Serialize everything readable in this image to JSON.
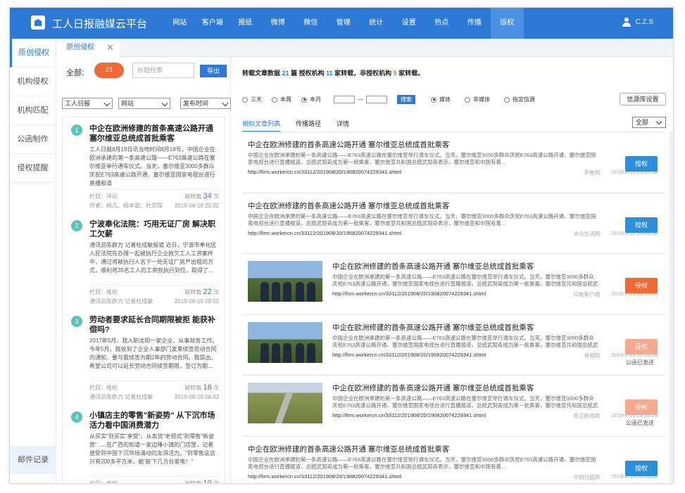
{
  "app": {
    "title": "工人日报融媒云平台",
    "user": "C.Z.S"
  },
  "nav": [
    "网站",
    "客户端",
    "报纸",
    "微博",
    "微信",
    "管理",
    "统计",
    "设置",
    "热点",
    "传播",
    "版权"
  ],
  "nav_active": "版权",
  "sidebar": {
    "items": [
      "原创侵权",
      "机构侵权",
      "机构匹配",
      "公函制作",
      "侵权提醒"
    ],
    "bottom": "邮件记录"
  },
  "tab": {
    "label": "原创侵权",
    "close": "✕"
  },
  "left": {
    "total_label": "全部:",
    "total_count": "21",
    "search_placeholder": "标题检索",
    "export": "导出",
    "selects": [
      "工人日报",
      "网站",
      "发布时间"
    ],
    "items": [
      {
        "no": "1",
        "title": "中企在欧洲修建的首条高速公路开通 塞尔维亚总统成首批乘客",
        "body": "工人日报8月19日讯当地时间8月18号，中国企业在欧洲承建的第一条高速公路——E763高速公路在塞尔维亚举行通车仪式。当天，塞尔维亚3000多群众庆祝E763高速公路开通，塞尔维亚国家电视台进行直播报道",
        "meta1_left": "栏目：评论",
        "meta1_right": "被转载",
        "count": "34",
        "unit": "次",
        "meta2_left": "作者：杨凡、杨本歌、杜宗琛",
        "date": "2019-08-19 20:02"
      },
      {
        "no": "2",
        "title": "宁波奉化法院：巧用无证厂房 解决职工欠薪",
        "body": "通讯员陈群力 记者杜成敏报道  近日，宁波市奉化区人民法院在办理一起被执行企业拖欠工人工资案件中，通过将被执行人名下一处无证厂房产出租的方式，顺利将35名工人的工资款执行到位，取得了...",
        "meta1_left": "栏目：维权",
        "meta1_right": "被转载",
        "count": "22",
        "unit": "次",
        "meta2_left": "通讯员陈群力 记者杜成敏",
        "date": "2019-08-19 09:50"
      },
      {
        "no": "3",
        "title": "劳动者要求延长合同期限被拒 能获补偿吗?",
        "body": "2017年5月，我入职沈阳一家企业，从事财务工作。今年5月，我收到了企业人事部门发来续签劳动合同的通知，要与我续签为期2年的劳动合同。我提出，希望公司可以延长劳动合同续签期限，签订为期...",
        "meta1_left": "栏目：维权",
        "meta1_right": "被转载",
        "count": "16",
        "unit": "次",
        "meta2_left": "通讯员陈群力 记者杜成敏",
        "date": "2019-08-18 08:43"
      },
      {
        "no": "4",
        "title": "小镇店主的零售\"新姿势\" 从下沉市场活力看中国消费潜力",
        "body": "从买实\"到买实\"享受\"、从卖货\"老把式\"到零售\"新姿势\"......在广西的知道一家边陲小镇的门店里，记者感受到中国下沉市场涌动的澎湃活力。\"到零售这店只有200多平方米，能'装'下几万台家电！\"",
        "meta1_left": "栏目：维权",
        "meta1_right": "被转载",
        "count": "10",
        "unit": "次",
        "meta2_left": "",
        "date": ""
      }
    ]
  },
  "right": {
    "summary": {
      "p1": "转载文章数据",
      "articles": "21",
      "p2": "篇  授权机构",
      "auth": "11",
      "p3": "家转载，非授权机构",
      "unauth": "5",
      "p4": "家转载。"
    },
    "filter": {
      "r1": "三天",
      "r2": "本周",
      "r3": "本月",
      "dash": "—",
      "search": "搜索",
      "r4": "媒体",
      "r5": "非媒体",
      "r6": "指定信源"
    },
    "source_button": "信源库设置",
    "subtabs": [
      "相似文章列表",
      "传播路径",
      "详情"
    ],
    "all_select": "全部",
    "articles": [
      {
        "title": "中企在欧洲修建的首条高速公路开通 塞尔维亚总统成首批乘客",
        "body": "中国企业在欧洲承建的第一条高速公路——E763高速公路在塞尔维亚举行通车仪式。当天，塞尔维亚3000多群众庆祝E763高速公路开通，塞尔维亚国家电视台进行直播报道，总统武契奇成为第一批乘客，塞尔维亚共和国总统武契奇表示，塞尔维亚和中国有着...",
        "url": "http://firm.workercn.cn/33112/201908/20/190820074229341.shtml",
        "source": "齐鲁网",
        "time": "2019-8-19 20:33:28",
        "button": "授权",
        "btype": "blue",
        "sent": "",
        "thumb": "none"
      },
      {
        "title": "中企在欧洲修建的首条高速公路开通 塞尔维亚总统成首批乘客",
        "body": "中国企业在欧洲承建的第一条高速公路——E763高速公路在塞尔维亚举行通车仪式。当天，塞尔维亚3000多群众庆祝E763高速公路开通，塞尔维亚国家电视台进行直播报道，总统武契奇成为第一批乘客，塞尔维亚共和国总统武契奇表示，塞尔维亚和中国有着...",
        "url": "http://firm.workercn.cn/33112/201908/20/190820074229341.shtml",
        "source": "大众生活网",
        "time": "2019-8-19 20:33:28",
        "button": "授权",
        "btype": "blue",
        "sent": "",
        "thumb": "none"
      },
      {
        "title": "中企在欧洲修建的首条高速公路开通 塞尔维亚总统成首批乘客",
        "body": "中国企业在欧洲承建的第一条高速公路——E763高速公路在塞尔维亚举行通车仪式。当天，塞尔维亚3000多群众庆祝E763高速公路开通，塞尔维亚国家电视台进行直播报道，总统武契奇成为第一批乘客，塞尔维亚共和国总统武契奇表示，塞尔维亚和中国有着...",
        "url": "http://firm.workercn.cn/33112/201908/20/190820074229341.shtml",
        "source": "闪电客户端",
        "time": "2019-8-19 20:33:28",
        "button": "侵权",
        "btype": "red",
        "sent": "",
        "thumb": "people"
      },
      {
        "title": "中企在欧洲修建的首条高速公路开通 塞尔维亚总统成首批乘客",
        "body": "中国企业在欧洲承建的第一条高速公路——E763高速公路在塞尔维亚举行通车仪式。当天，塞尔维亚3000多群众庆祝E763高速公路开通，塞尔维亚国家电视台进行直播报道，总统武契奇成为第一批乘客，塞尔维亚共和国总统武契奇表示，塞尔维亚和中国有着...",
        "url": "http://firm.workercn.cn/33112/201908/20/190820074229341.shtml",
        "source": "青报网",
        "time": "2019-8-19 20:33:28",
        "button": "侵权",
        "btype": "pale",
        "sent": "公函已发送",
        "thumb": "people"
      },
      {
        "title": "中企在欧洲修建的首条高速公路开通 塞尔维亚总统成首批乘客",
        "body": "中国企业在欧洲承建的第一条高速公路——E763高速公路在塞尔维亚举行通车仪式。当天，塞尔维亚3000多群众庆祝E763高速公路开通，塞尔维亚国家电视台进行直播报道，总统武契奇成为第一批乘客，塞尔维亚共和国总统武契奇表示，塞尔维亚和中国有着...",
        "url": "http://firm.workercn.cn/33112/201908/20/190820074229341.shtml",
        "source": "枣庄新闻网",
        "time": "2019-8-19 20:33:28",
        "button": "侵权",
        "btype": "pale",
        "sent": "公函已发送",
        "thumb": "road"
      },
      {
        "title": "中企在欧洲修建的首条高速公路开通 塞尔维亚总统成首批乘客",
        "body": "中国企业在欧洲承建的第一条高速公路——E763高速公路在塞尔维亚举行通车仪式。当天，塞尔维亚3000多群众庆祝E763高速公路开通，塞尔维亚国家电视台进行直播报道，总统武契奇成为第一批乘客，塞尔维亚共和国总统武契奇表示，塞尔维亚和中国有着...",
        "url": "http://firm.workercn.cn/33112/201908/20/190820074229341.shtml",
        "source": "中国日报网",
        "time": "2019-8-19 20:33:28",
        "button": "授权",
        "btype": "blue",
        "sent": "",
        "thumb": "none"
      }
    ]
  }
}
